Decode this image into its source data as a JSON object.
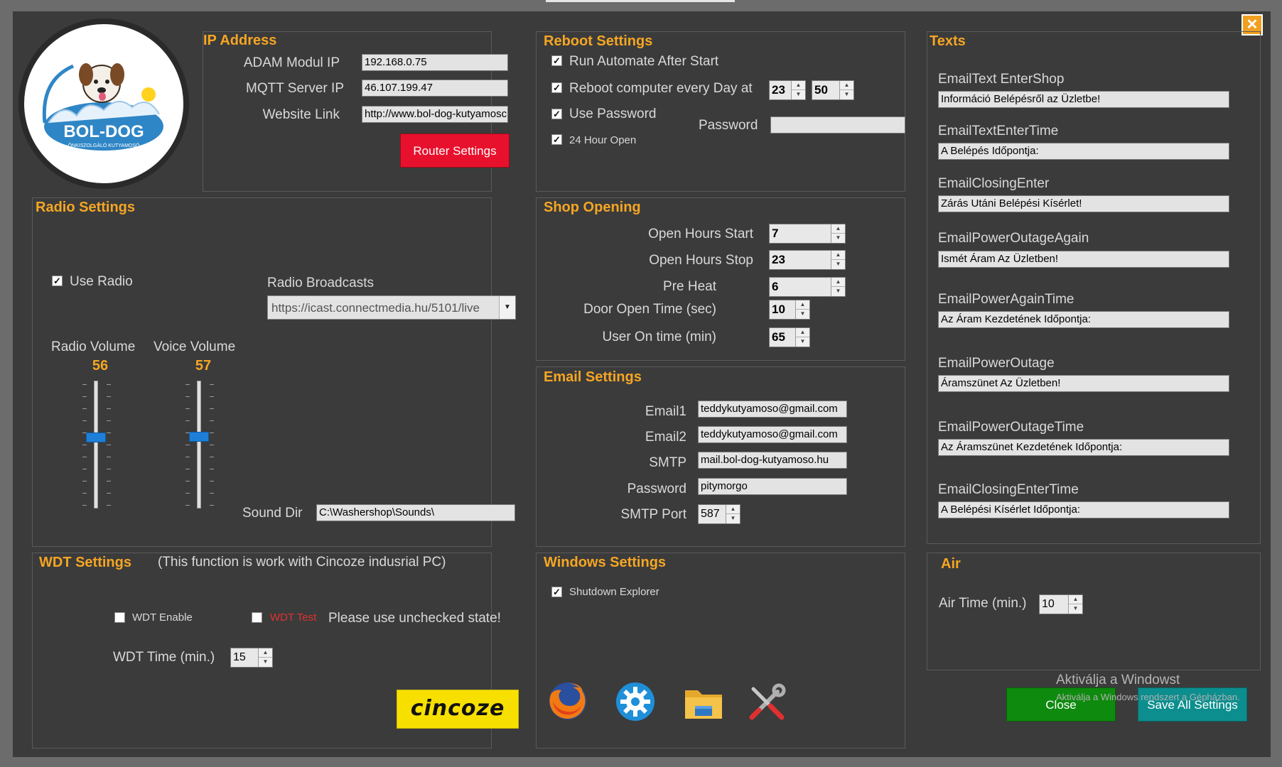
{
  "window": {
    "close_glyph": "✕"
  },
  "ip": {
    "title": "IP Address",
    "adam_label": "ADAM Modul IP",
    "adam_value": "192.168.0.75",
    "mqtt_label": "MQTT Server IP",
    "mqtt_value": "46.107.199.47",
    "website_label": "Website Link",
    "website_value": "http://www.bol-dog-kutyamosc",
    "router_button": "Router Settings"
  },
  "logo": {
    "text": "BOL-DOG",
    "subtext": "ÖNKISZOLGÁLÓ KUTYAMOSÓ"
  },
  "reboot": {
    "title": "Reboot Settings",
    "run_automate": "Run Automate After Start",
    "reboot_every_day": "Reboot computer every Day at",
    "hour": "23",
    "minute": "50",
    "use_password": "Use Password",
    "password_label": "Password",
    "password_value": "",
    "open_24": "24 Hour Open"
  },
  "texts": {
    "title": "Texts",
    "items": [
      {
        "label": "EmailText EnterShop",
        "value": "Információ Belépésről az Üzletbe!"
      },
      {
        "label": "EmailTextEnterTime",
        "value": "A Belépés Időpontja:"
      },
      {
        "label": "EmailClosingEnter",
        "value": "Zárás Utáni Belépési Kísérlet!"
      },
      {
        "label": "EmailPowerOutageAgain",
        "value": "Ismét Áram Az Üzletben!"
      },
      {
        "label": "EmailPowerAgainTime",
        "value": "Az Áram Kezdetének Időpontja:"
      },
      {
        "label": "EmailPowerOutage",
        "value": "Áramszünet Az Üzletben!"
      },
      {
        "label": "EmailPowerOutageTime",
        "value": "Az Áramszünet Kezdetének Időpontja:"
      },
      {
        "label": "EmailClosingEnterTime",
        "value": "A Belépési Kísérlet Időpontja:"
      }
    ]
  },
  "radio": {
    "title": "Radio Settings",
    "use_radio": "Use Radio",
    "broadcasts_label": "Radio Broadcasts",
    "broadcast_value": "https://icast.connectmedia.hu/5101/live",
    "radio_volume_label": "Radio Volume",
    "radio_volume": "56",
    "voice_volume_label": "Voice Volume",
    "voice_volume": "57",
    "sound_dir_label": "Sound Dir",
    "sound_dir_value": "C:\\Washershop\\Sounds\\"
  },
  "shop": {
    "title": "Shop Opening",
    "open_start_label": "Open Hours Start",
    "open_start": "7",
    "open_stop_label": "Open Hours Stop",
    "open_stop": "23",
    "preheat_label": "Pre Heat",
    "preheat": "6",
    "door_label": "Door Open Time (sec)",
    "door": "10",
    "user_on_label": "User On time (min)",
    "user_on": "65"
  },
  "email": {
    "title": "Email Settings",
    "email1_label": "Email1",
    "email1": "teddykutyamoso@gmail.com",
    "email2_label": "Email2",
    "email2": "teddykutyamoso@gmail.com",
    "smtp_label": "SMTP",
    "smtp": "mail.bol-dog-kutyamoso.hu",
    "password_label": "Password",
    "password": "pitymorgo",
    "port_label": "SMTP Port",
    "port": "587"
  },
  "wdt": {
    "title": "WDT  Settings",
    "note": "(This function is work with Cincoze indusrial PC)",
    "enable": "WDT Enable",
    "test": "WDT Test",
    "warning": "Please use unchecked state!",
    "time_label": "WDT Time (min.)",
    "time": "15",
    "brand": "cincoze"
  },
  "windows": {
    "title": "Windows  Settings",
    "shutdown_explorer": "Shutdown Explorer"
  },
  "air": {
    "title": "Air",
    "time_label": "Air Time (min.)",
    "time": "10"
  },
  "buttons": {
    "close": "Close",
    "save": "Save All Settings"
  },
  "watermark": {
    "line1": "Aktiválja a Windowst",
    "line2": "Aktiválja a Windows rendszert a Gépházban."
  },
  "colors": {
    "accent": "#f5a623",
    "router": "#e8112d",
    "close_btn": "#0e8a0e",
    "save_btn": "#0c8e8e"
  }
}
